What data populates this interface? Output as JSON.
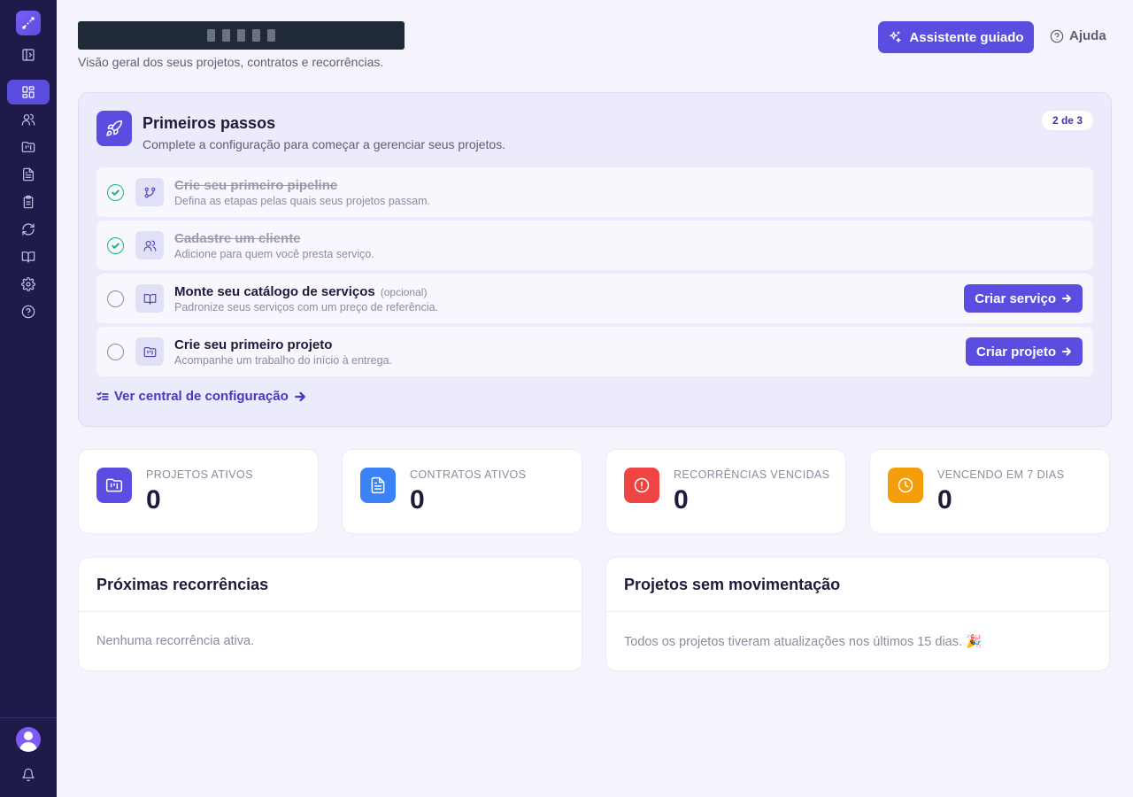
{
  "header": {
    "subtitle": "Visão geral dos seus projetos, contratos e recorrências.",
    "assistant_label": "Assistente guiado",
    "help_label": "Ajuda"
  },
  "sidebar": {
    "items": [
      {
        "icon": "dashboard-icon",
        "active": true
      },
      {
        "icon": "users-icon"
      },
      {
        "icon": "folder-kanban-icon"
      },
      {
        "icon": "file-text-icon"
      },
      {
        "icon": "clipboard-icon"
      },
      {
        "icon": "refresh-icon"
      },
      {
        "icon": "book-open-icon"
      },
      {
        "icon": "settings-icon"
      },
      {
        "icon": "help-circle-icon"
      }
    ]
  },
  "getting_started": {
    "title": "Primeiros passos",
    "subtitle": "Complete a configuração para começar a gerenciar seus projetos.",
    "progress": "2 de 3",
    "steps": [
      {
        "title": "Crie seu primeiro pipeline",
        "desc": "Defina as etapas pelas quais seus projetos passam.",
        "done": true,
        "icon": "git-branch-icon"
      },
      {
        "title": "Cadastre um cliente",
        "desc": "Adicione para quem você presta serviço.",
        "done": true,
        "icon": "users-icon"
      },
      {
        "title": "Monte seu catálogo de serviços",
        "optional": "(opcional)",
        "desc": "Padronize seus serviços com um preço de referência.",
        "done": false,
        "icon": "book-open-icon",
        "button": "Criar serviço"
      },
      {
        "title": "Crie seu primeiro projeto",
        "desc": "Acompanhe um trabalho do início à entrega.",
        "done": false,
        "icon": "folder-kanban-icon",
        "button": "Criar projeto"
      }
    ],
    "link_label": "Ver central de configuração"
  },
  "stats": [
    {
      "label": "PROJETOS ATIVOS",
      "value": "0",
      "color": "#5b4de0",
      "icon": "folder-kanban-icon"
    },
    {
      "label": "CONTRATOS ATIVOS",
      "value": "0",
      "color": "#3b82f6",
      "icon": "file-text-icon"
    },
    {
      "label": "RECORRÊNCIAS VENCIDAS",
      "value": "0",
      "color": "#ef4444",
      "icon": "alert-circle-icon"
    },
    {
      "label": "VENCENDO EM 7 DIAS",
      "value": "0",
      "color": "#f59e0b",
      "icon": "clock-icon"
    }
  ],
  "panels": [
    {
      "title": "Próximas recorrências",
      "body": "Nenhuma recorrência ativa."
    },
    {
      "title": "Projetos sem movimentação",
      "body": "Todos os projetos tiveram atualizações nos últimos 15 dias. 🎉"
    }
  ],
  "colors": {
    "sidebar": "#1e1b4b",
    "accent": "#5b4de0",
    "success": "#10b981"
  }
}
